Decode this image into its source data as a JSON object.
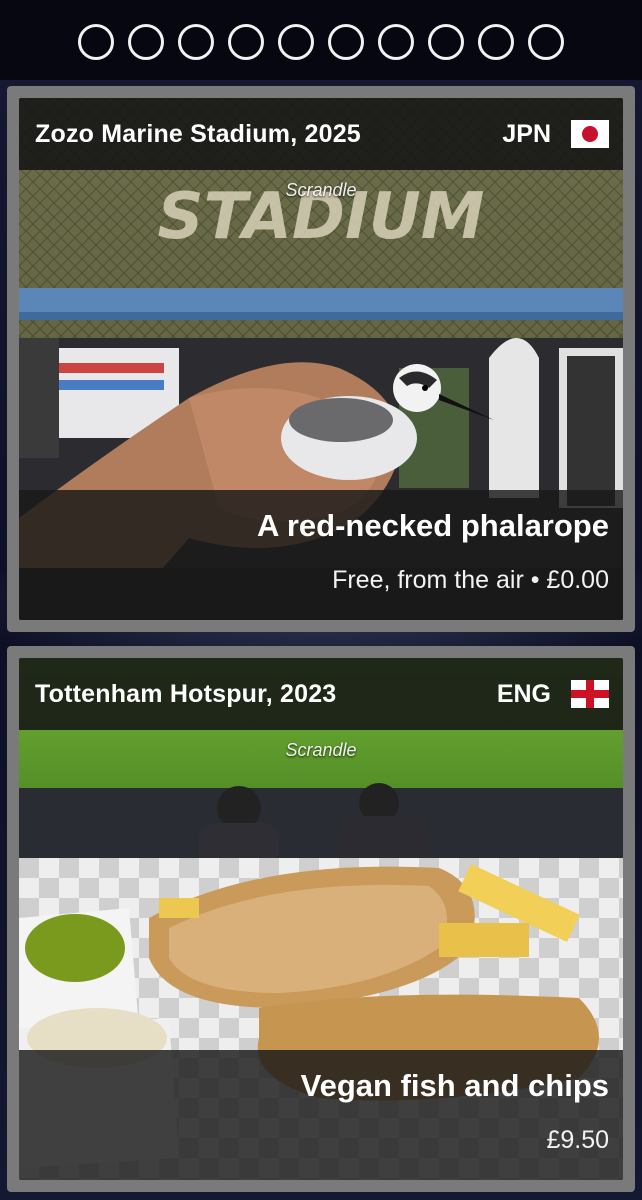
{
  "pagination": {
    "count": 10
  },
  "cards": [
    {
      "place": "Zozo Marine Stadium, 2025",
      "country": "JPN",
      "flag": "japan-flag-icon",
      "watermark": "Scrandle",
      "dish": "A red-necked phalarope",
      "price": "Free, from the air • £0.00",
      "photo_sign_text": "STADIUM"
    },
    {
      "place": "Tottenham Hotspur, 2023",
      "country": "ENG",
      "flag": "england-flag-icon",
      "watermark": "Scrandle",
      "dish": "Vegan fish and chips",
      "price": "£9.50"
    }
  ],
  "colors": {
    "background": "#0c0e1c",
    "card_border": "#7a7a7a",
    "overlay": "#141614",
    "japan_red": "#c8102e",
    "england_red": "#ce1124"
  }
}
